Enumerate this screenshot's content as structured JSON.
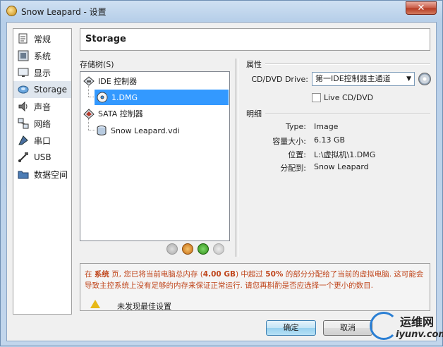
{
  "window": {
    "title": "Snow Leapard - 设置",
    "close": "✕"
  },
  "nav": {
    "items": [
      {
        "label": "常规",
        "icon": "general-icon"
      },
      {
        "label": "系统",
        "icon": "system-icon"
      },
      {
        "label": "显示",
        "icon": "display-icon"
      },
      {
        "label": "Storage",
        "icon": "storage-icon"
      },
      {
        "label": "声音",
        "icon": "audio-icon"
      },
      {
        "label": "网络",
        "icon": "network-icon"
      },
      {
        "label": "串口",
        "icon": "serial-port-icon"
      },
      {
        "label": "USB",
        "icon": "usb-icon"
      },
      {
        "label": "数据空间",
        "icon": "shared-folder-icon"
      }
    ],
    "selected_index": 3
  },
  "header": {
    "title": "Storage"
  },
  "tree": {
    "label": "存储树(S)",
    "controllers": [
      {
        "name": "IDE 控制器",
        "attachments": [
          "1.DMG"
        ]
      },
      {
        "name": "SATA 控制器",
        "attachments": [
          "Snow Leapard.vdi"
        ]
      }
    ]
  },
  "attributes": {
    "title": "属性",
    "drive_label": "CD/DVD Drive:",
    "drive_value": "第一IDE控制器主通道",
    "live_cd_label": "Live CD/DVD",
    "live_cd_checked": false
  },
  "details": {
    "title": "明细",
    "rows": [
      {
        "label": "Type:",
        "value": "Image"
      },
      {
        "label": "容量大小:",
        "value": "6.13 GB"
      },
      {
        "label": "位置:",
        "value": "L:\\虚拟机\\1.DMG"
      },
      {
        "label": "分配到:",
        "value": "Snow Leapard"
      }
    ]
  },
  "warning": {
    "p1": "在 ",
    "b1": "系统",
    "p2": " 页, 您已将当前电脑总内存 (",
    "b2": "4.00 GB",
    "p3": ") 中超过 ",
    "b3": "50%",
    "p4": " 的部分分配给了当前的虚拟电脑. 这可能会导致主控系统上没有足够的内存来保证正常运行. 请您再斟酌是否应选择一个更小的数目."
  },
  "status": {
    "text": "未发现最佳设置"
  },
  "buttons": {
    "ok": "确定",
    "cancel": "取消"
  },
  "watermark": {
    "line1": "运维网",
    "line2": "iyunv.com"
  }
}
